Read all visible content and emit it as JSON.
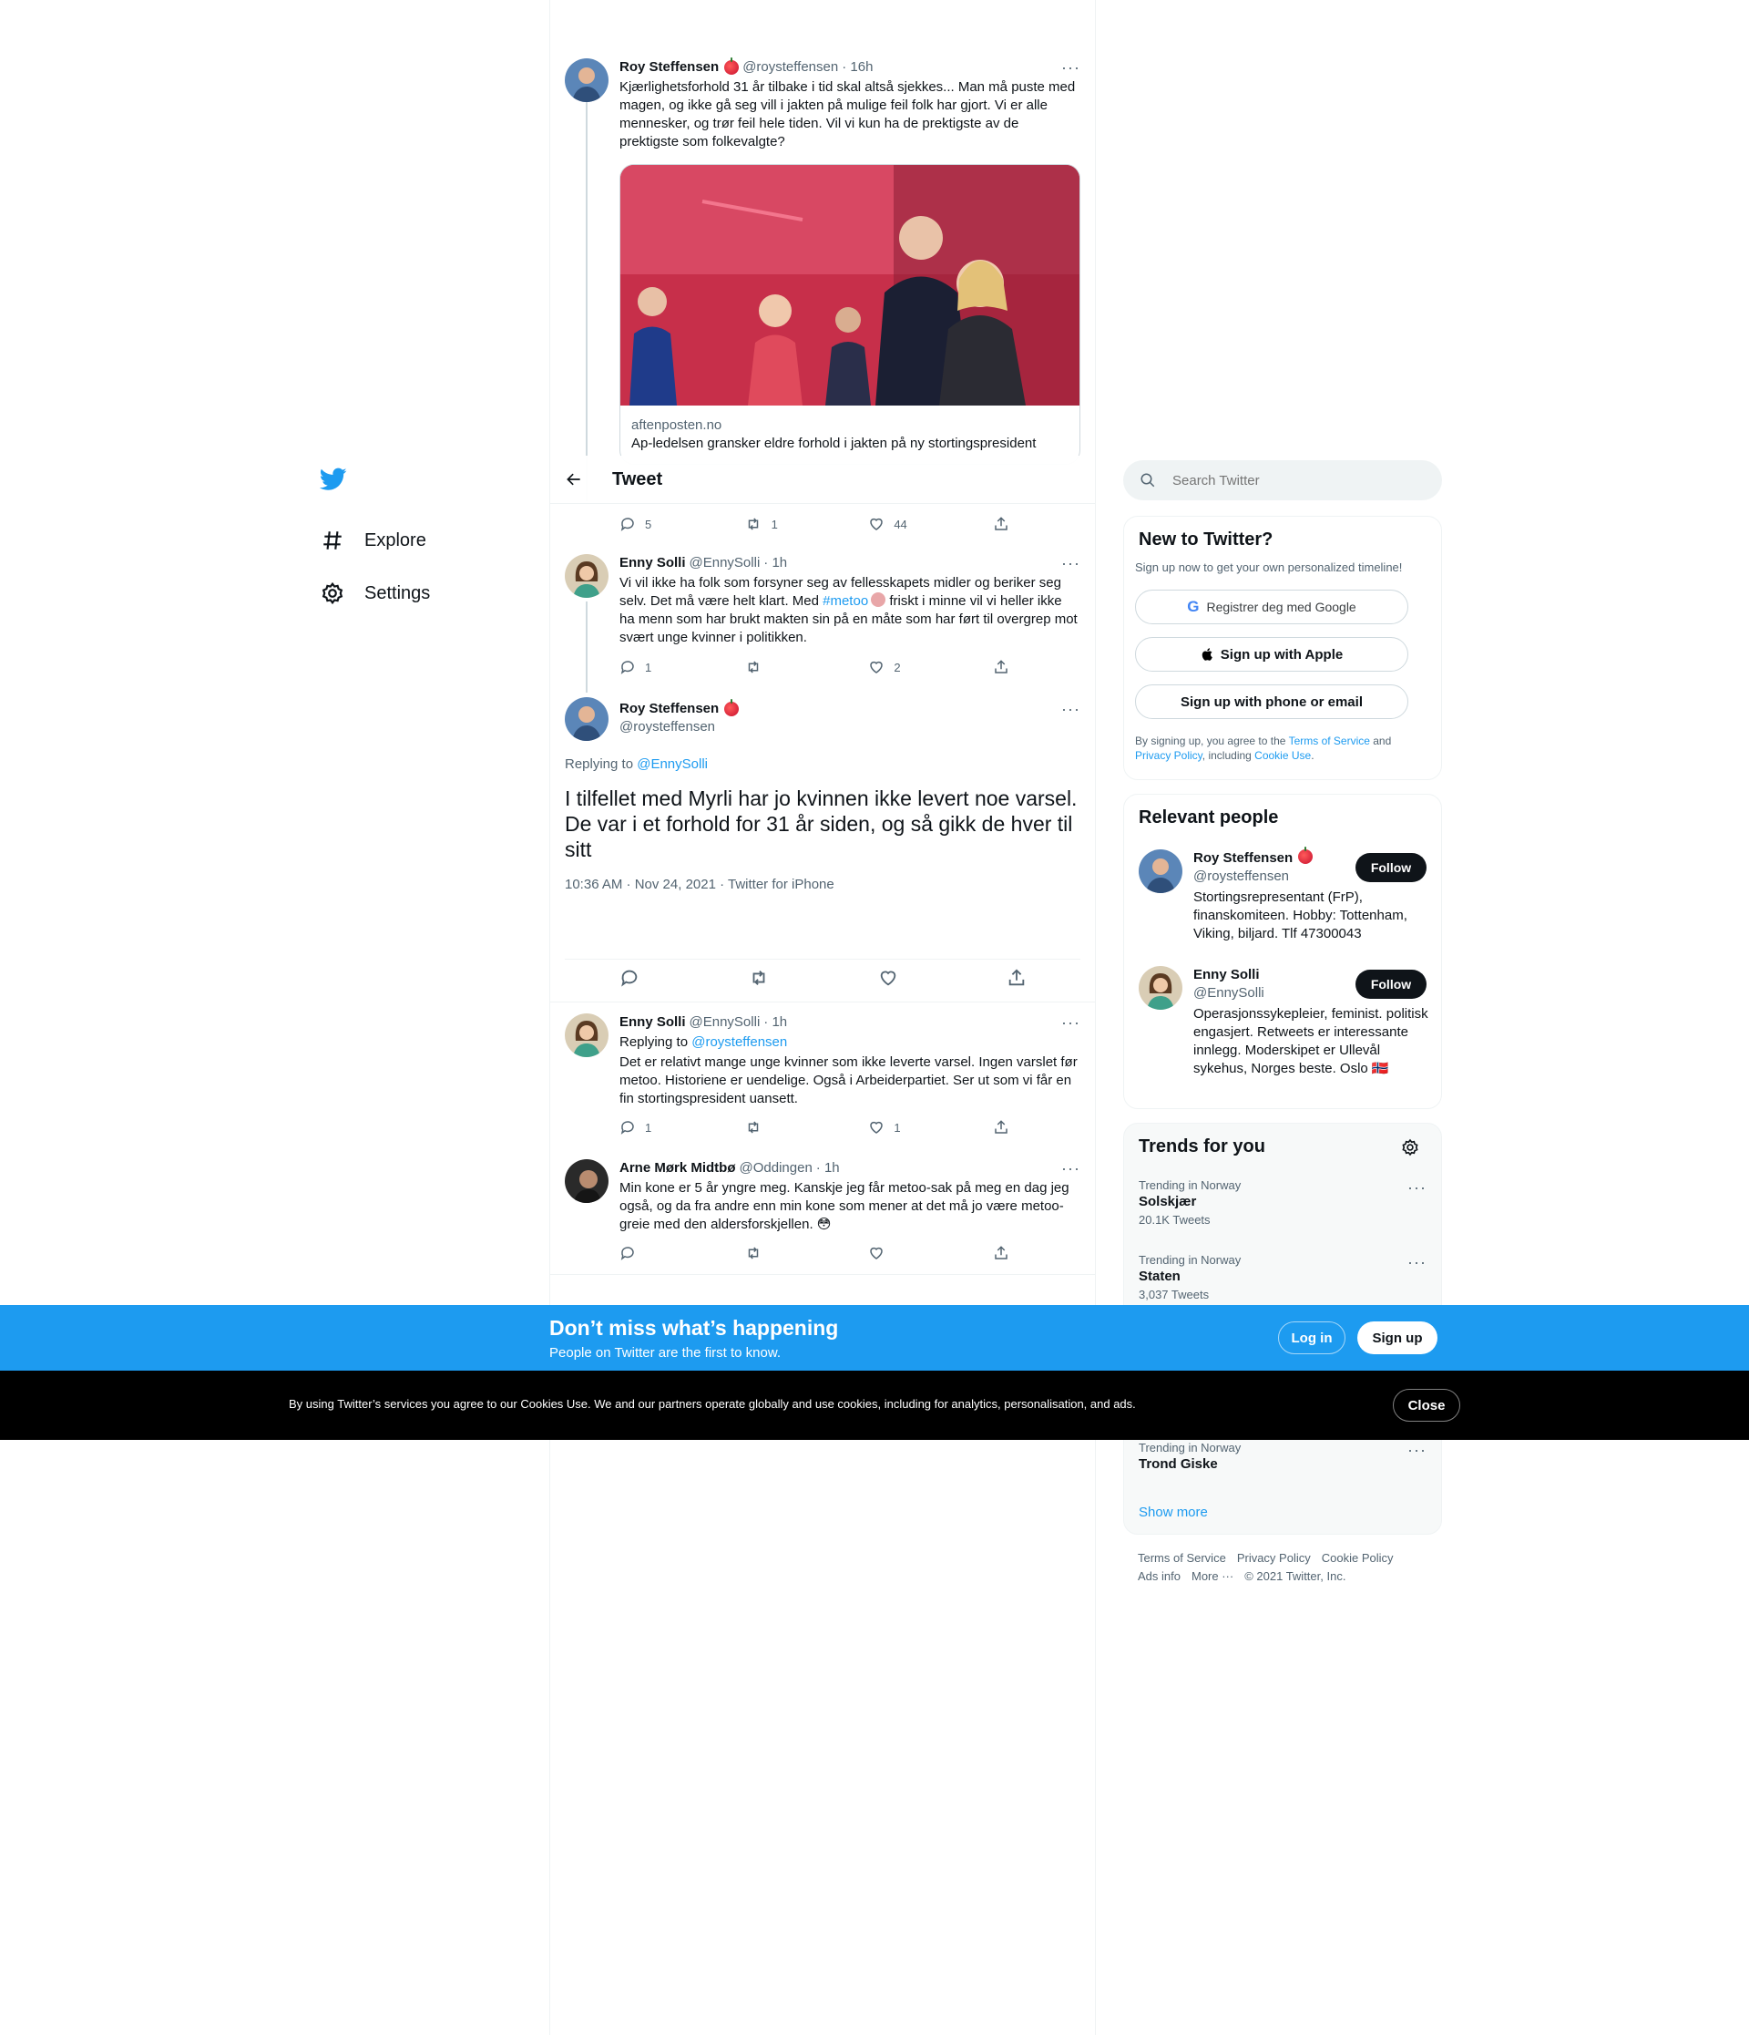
{
  "nav": {
    "explore": "Explore",
    "settings": "Settings"
  },
  "header": {
    "title": "Tweet"
  },
  "thread": {
    "t1": {
      "name": "Roy Steffensen",
      "handle": "@roysteffensen",
      "time": "· 16h",
      "text": "Kjærlighetsforhold 31 år tilbake i tid skal altså sjekkes... Man må puste med magen, og ikke gå seg vill i jakten på mulige feil folk har gjort. Vi er alle mennesker, og trør feil hele tiden. Vil vi kun ha de prektigste av de prektigste som folkevalgte?",
      "card_domain": "aftenposten.no",
      "card_title": "Ap-ledelsen gransker eldre forhold i jakten på ny stortingspresident",
      "replies": "5",
      "retweets": "1",
      "likes": "44"
    },
    "t2": {
      "name": "Enny Solli",
      "handle": "@EnnySolli",
      "time": "· 1h",
      "text_a": "Vi vil ikke ha folk som forsyner seg av fellesskapets midler og beriker seg selv. Det må være helt klart. Med ",
      "hashtag": "#metoo",
      "text_b": " friskt i minne vil vi heller ikke ha menn som har brukt makten sin på en måte som har ført til overgrep mot svært unge kvinner i politikken.",
      "replies": "1",
      "likes": "2"
    },
    "main": {
      "name": "Roy Steffensen",
      "handle": "@roysteffensen",
      "replying_label": "Replying to ",
      "replying_to": "@EnnySolli",
      "text": "I tilfellet med Myrli har jo kvinnen ikke levert noe varsel. De var i et forhold for 31 år siden, og så gikk de hver til sitt",
      "meta": "10:36 AM · Nov 24, 2021 · Twitter for iPhone"
    },
    "r1": {
      "name": "Enny Solli",
      "handle": "@EnnySolli",
      "time": "· 1h",
      "replying_label": "Replying to ",
      "replying_to": "@roysteffensen",
      "text": "Det er relativt mange unge kvinner som ikke leverte varsel. Ingen varslet før metoo. Historiene er uendelige. Også i Arbeiderpartiet. Ser ut som vi får en fin stortingspresident uansett.",
      "replies": "1",
      "likes": "1"
    },
    "r2": {
      "name": "Arne Mørk Midtbø",
      "handle": "@Oddingen",
      "time": "· 1h",
      "text": "Min kone er 5 år yngre meg. Kanskje jeg får metoo-sak på meg en dag jeg også, og da fra andre enn min kone som mener at det må jo være metoo-greie med den aldersforskjellen. 😳"
    }
  },
  "search": {
    "placeholder": "Search Twitter"
  },
  "signup": {
    "title": "New to Twitter?",
    "subtitle": "Sign up now to get your own personalized timeline!",
    "google": "Registrer deg med Google",
    "apple": "Sign up with Apple",
    "phone": "Sign up with phone or email",
    "legal_a": "By signing up, you agree to the ",
    "terms": "Terms of Service",
    "legal_b": " and ",
    "privacy": "Privacy Policy",
    "legal_c": ", including ",
    "cookie": "Cookie Use",
    "legal_d": "."
  },
  "relevant": {
    "title": "Relevant people",
    "people": [
      {
        "name": "Roy Steffensen",
        "handle": "@roysteffensen",
        "bio": "Stortingsrepresentant (FrP), finanskomiteen. Hobby: Tottenham, Viking, biljard. Tlf 47300043",
        "follow": "Follow"
      },
      {
        "name": "Enny Solli",
        "handle": "@EnnySolli",
        "bio": "Operasjonssykepleier, feminist. politisk engasjert. Retweets er interessante innlegg. Moderskipet er Ullevål sykehus, Norges beste. Oslo 🇳🇴",
        "follow": "Follow"
      }
    ]
  },
  "trends": {
    "title": "Trends for you",
    "items": [
      {
        "context": "Trending in Norway",
        "topic": "Solskjær",
        "count": "20.1K Tweets"
      },
      {
        "context": "Trending in Norway",
        "topic": "Staten",
        "count": "3,037 Tweets"
      },
      {
        "context": "Trending in Norway",
        "topic": "Trond Giske",
        "count": ""
      }
    ],
    "show_more": "Show more"
  },
  "footer": {
    "terms": "Terms of Service",
    "privacy": "Privacy Policy",
    "cookie": "Cookie Policy",
    "ads": "Ads info",
    "more": "More ···",
    "copyright": "© 2021 Twitter, Inc."
  },
  "banner": {
    "title": "Don’t miss what’s happening",
    "subtitle": "People on Twitter are the first to know.",
    "login": "Log in",
    "signup": "Sign up"
  },
  "cookies": {
    "text": "By using Twitter’s services you agree to our Cookies Use. We and our partners operate globally and use cookies, including for analytics, personalisation, and ads.",
    "close": "Close"
  }
}
